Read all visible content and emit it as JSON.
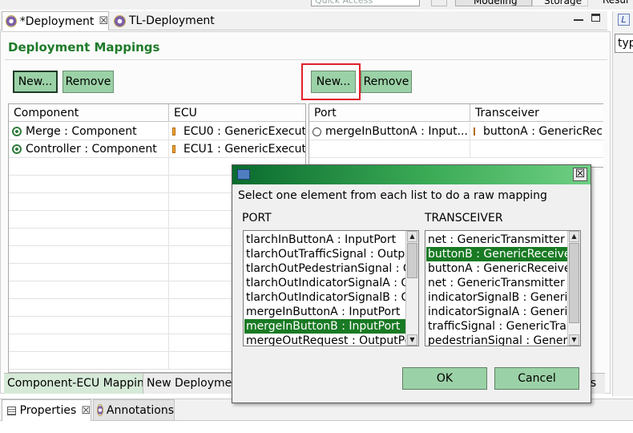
{
  "top_bar": {
    "quick_access_placeholder": "Quick Access",
    "perspectives": [
      "Modeling",
      "Storage",
      "Resul"
    ]
  },
  "editor_tabs": [
    {
      "label": "*Deployment",
      "close": "☒"
    },
    {
      "label": "TL-Deployment"
    }
  ],
  "page": {
    "title": "Deployment Mappings",
    "left_buttons": {
      "new": "New...",
      "remove": "Remove"
    },
    "right_buttons": {
      "new": "New...",
      "remove": "Remove"
    }
  },
  "left_table": {
    "columns": [
      "Component",
      "ECU"
    ],
    "rows": [
      {
        "component": "Merge : Component",
        "ecu": "ECU0 : GenericExecut"
      },
      {
        "component": "Controller : Component",
        "ecu": "ECU1 : GenericExecut"
      }
    ]
  },
  "right_table": {
    "columns": [
      "Port",
      "Transceiver"
    ],
    "rows": [
      {
        "port": "mergeInButtonA : Input...",
        "transceiver": "buttonA : GenericRece"
      }
    ]
  },
  "page_tabs": [
    "Component-ECU Mapping",
    "New Deploymen",
    "gs"
  ],
  "side_panel": {
    "input_value": "typ"
  },
  "view_tabs": [
    {
      "label": "Properties",
      "close": "☒"
    },
    {
      "label": "Annotations"
    }
  ],
  "dialog": {
    "close": "☒",
    "message": "Select one element from each list to do a raw mapping",
    "port_label": "PORT",
    "transceiver_label": "TRANSCEIVER",
    "port_items": [
      "tlarchInButtonA : InputPort",
      "tlarchOutTrafficSignal : OutputP",
      "tlarchOutPedestrianSignal : Out",
      "tlarchOutIndicatorSignalA : Out",
      "tlarchOutIndicatorSignalB : Out",
      "mergeInButtonA : InputPort",
      "mergeInButtonB : InputPort",
      "mergeOutRequest : OutputPor"
    ],
    "port_selected_index": 6,
    "transceiver_items": [
      "net : GenericTransmitter",
      "buttonB : GenericReceiver",
      "buttonA : GenericReceiver",
      "net : GenericTransmitter",
      "indicatorSignalB : GenericTr",
      "indicatorSignalA : GenericTr",
      "trafficSignal : GenericTrans",
      "pedestrianSignal : GenericT"
    ],
    "transceiver_selected_index": 1,
    "ok": "OK",
    "cancel": "Cancel"
  },
  "colors": {
    "title_green": "#1f7a2a",
    "button_green": "#9bd1a6",
    "selection_green": "#197a24",
    "highlight_red": "#e3202a"
  }
}
